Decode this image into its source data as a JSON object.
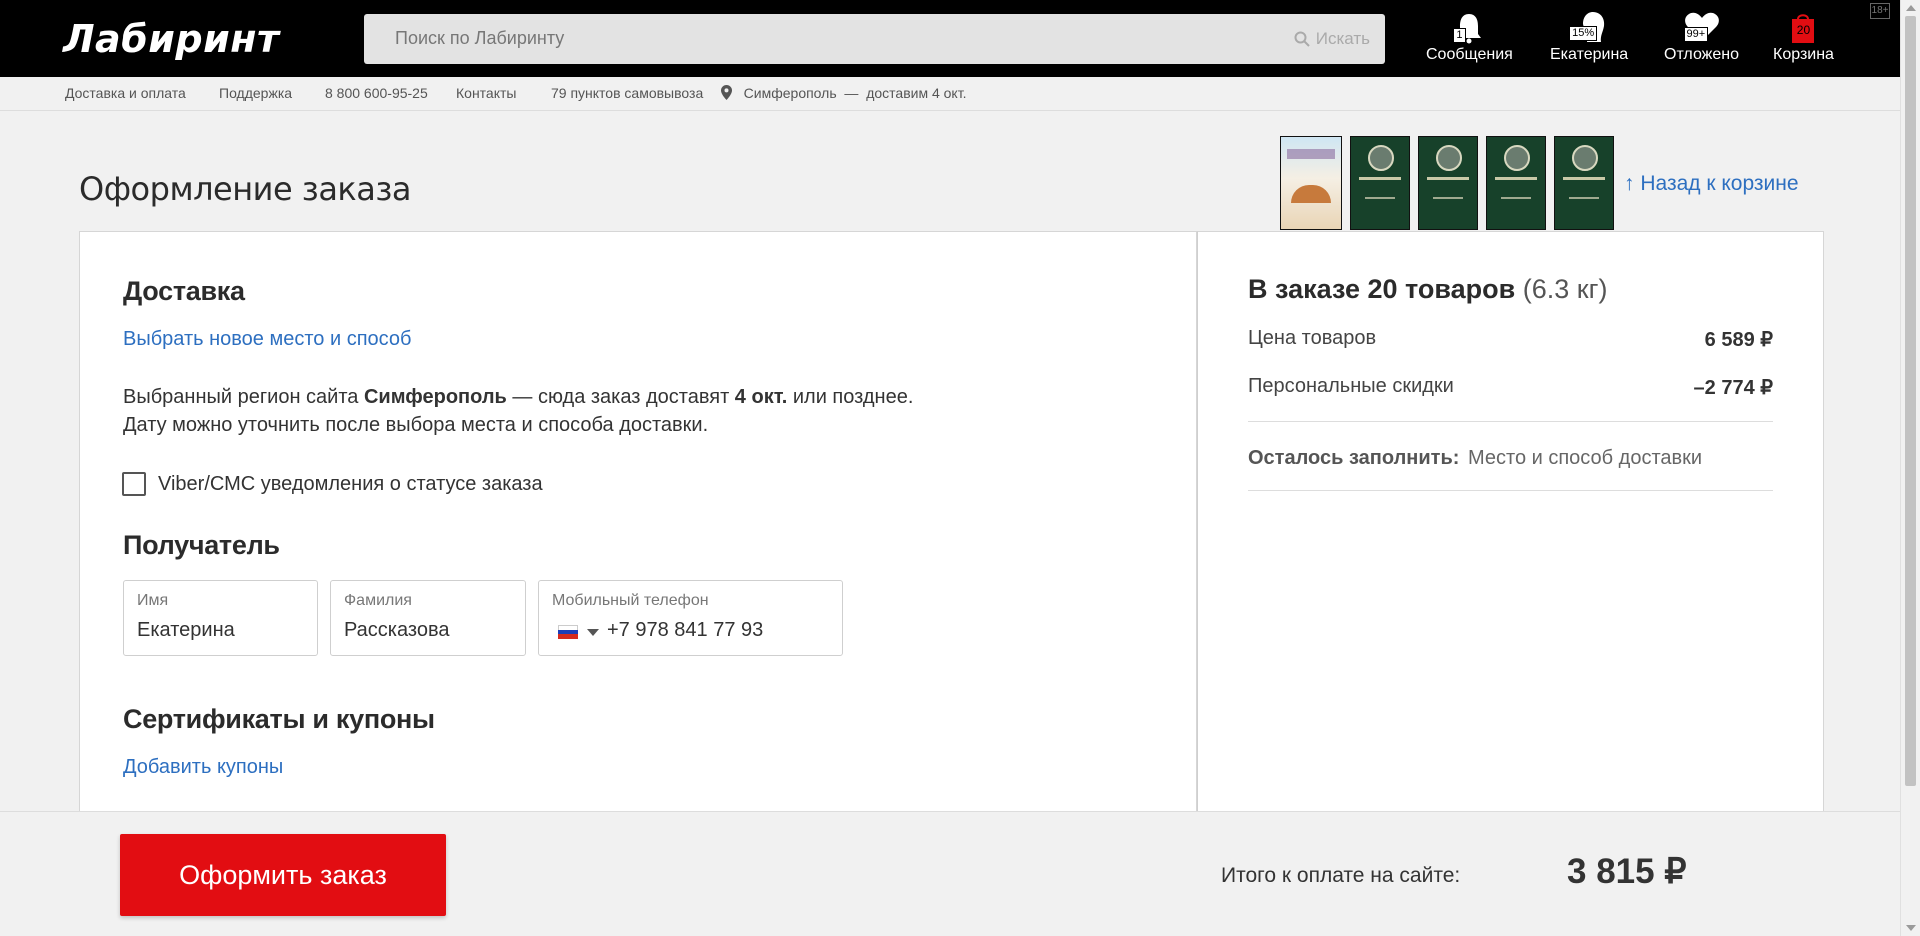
{
  "header": {
    "logo": "Лабиринт",
    "search_placeholder": "Поиск по Лабиринту",
    "search_button": "Искать",
    "items": [
      {
        "label": "Сообщения",
        "badge": "1"
      },
      {
        "label": "Екатерина",
        "badge": "15%"
      },
      {
        "label": "Отложено",
        "badge": "99+"
      },
      {
        "label": "Корзина",
        "badge": "20"
      }
    ],
    "age_rating": "18+"
  },
  "subnav": {
    "delivery": "Доставка и оплата",
    "support": "Поддержка",
    "phone": "8 800 600-95-25",
    "contacts": "Контакты",
    "pickup": "79 пунктов самовывоза",
    "city": "Симферополь",
    "dash": "—",
    "eta": "доставим 4 окт."
  },
  "page": {
    "title": "Оформление заказа",
    "back_link": "↑ Назад к корзине"
  },
  "delivery": {
    "heading": "Доставка",
    "choose_link": "Выбрать новое место и способ",
    "line1_a": "Выбранный регион сайта",
    "line1_city": "Симферополь",
    "line1_b": "— сюда заказ доставят",
    "line1_date": "4 окт.",
    "line1_c": "или позднее.",
    "line2": "Дату можно уточнить после выбора места и способа доставки.",
    "notify_label": "Viber/СМС уведомления о статусе заказа"
  },
  "recipient": {
    "heading": "Получатель",
    "first_name_label": "Имя",
    "first_name": "Екатерина",
    "last_name_label": "Фамилия",
    "last_name": "Рассказова",
    "phone_label": "Мобильный телефон",
    "phone": "+7 978 841 77 93"
  },
  "coupons": {
    "heading": "Сертификаты и купоны",
    "add_link": "Добавить купоны"
  },
  "summary": {
    "title_bold": "В заказе 20 товаров",
    "weight": "(6.3 кг)",
    "price_label": "Цена товаров",
    "price_value": "6 589 ₽",
    "discount_label": "Персональные скидки",
    "discount_value": "–2 774 ₽",
    "remain_label": "Осталось заполнить:",
    "remain_value": "Место и способ доставки"
  },
  "footer": {
    "submit": "Оформить заказ",
    "total_label": "Итого к оплате на сайте:",
    "total_value": "3 815 ₽"
  },
  "colors": {
    "accent_red": "#e20d12",
    "link_blue": "#2d6fc0",
    "header_black": "#000000",
    "book_green": "#17412a"
  }
}
